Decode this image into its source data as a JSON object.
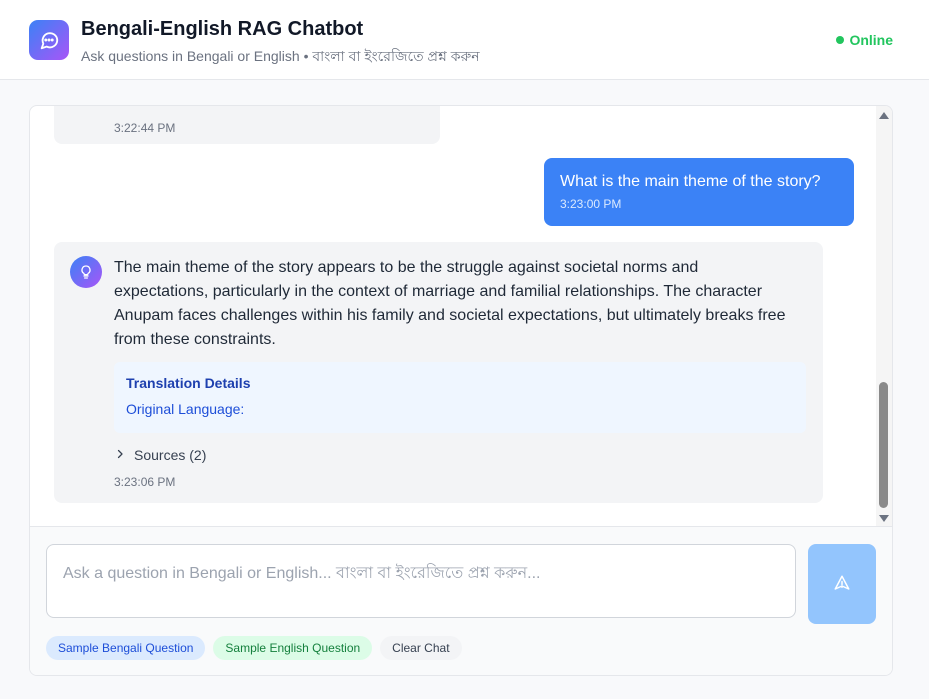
{
  "header": {
    "title": "Bengali-English RAG Chatbot",
    "subtitle": "Ask questions in Bengali or English • বাংলা বা ইংরেজিতে প্রশ্ন করুন",
    "status": "Online",
    "status_color": "#22c55e",
    "logo_icon": "chat-bubble-icon"
  },
  "messages": [
    {
      "role": "bot",
      "timestamp": "3:22:44 PM"
    },
    {
      "role": "user",
      "text": "What is the main theme of the story?",
      "timestamp": "3:23:00 PM"
    },
    {
      "role": "bot",
      "avatar_icon": "lightbulb-icon",
      "text": "The main theme of the story appears to be the struggle against societal norms and expectations, particularly in the context of marriage and familial relationships. The character Anupam faces challenges within his family and societal expectations, but ultimately breaks free from these constraints.",
      "translation": {
        "title": "Translation Details",
        "original_language_label": "Original Language:"
      },
      "sources_label": "Sources (2)",
      "timestamp": "3:23:06 PM"
    }
  ],
  "input": {
    "placeholder": "Ask a question in Bengali or English... বাংলা বা ইংরেজিতে প্রশ্ন করুন...",
    "value": "",
    "send_icon": "send-icon"
  },
  "quick_actions": {
    "bengali": "Sample Bengali Question",
    "english": "Sample English Question",
    "clear": "Clear Chat"
  },
  "colors": {
    "accent": "#3b82f6",
    "user_bubble": "#3b82f6",
    "bot_bubble": "#f3f4f6"
  }
}
